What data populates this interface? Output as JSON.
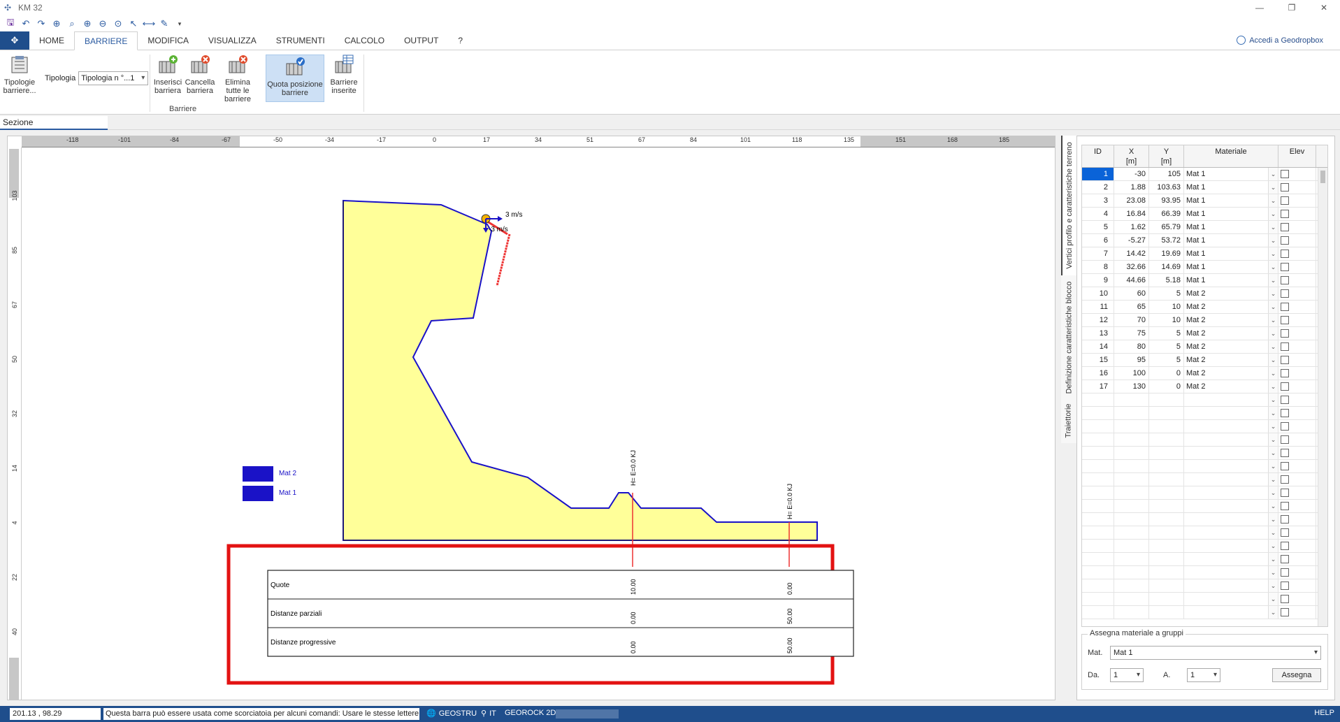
{
  "window": {
    "title": "KM 32"
  },
  "ribbon": {
    "tabs": [
      "HOME",
      "BARRIERE",
      "MODIFICA",
      "VISUALIZZA",
      "STRUMENTI",
      "CALCOLO",
      "OUTPUT",
      "?"
    ],
    "active_tab": "BARRIERE",
    "account_label": "Accedi a Geodropbox",
    "buttons": {
      "tipologie": "Tipologie barriere...",
      "tipologia_label": "Tipologia",
      "tipologia_value": "Tipologia n °...1",
      "inserisci": "Inserisci barriera",
      "cancella": "Cancella barriera",
      "elimina": "Elimina tutte le barriere",
      "quota": "Quota posizione barriere",
      "inserite": "Barriere inserite"
    },
    "group_label": "Barriere"
  },
  "section_tab": "Sezione",
  "canvas": {
    "h_ruler_labels": [
      "-118",
      "-101",
      "-84",
      "-67",
      "-50",
      "-34",
      "-17",
      "0",
      "17",
      "34",
      "51",
      "67",
      "84",
      "101",
      "118",
      "135",
      "151",
      "168",
      "185"
    ],
    "v_ruler_labels": [
      "103",
      "85",
      "67",
      "50",
      "32",
      "14",
      "4",
      "22",
      "40"
    ],
    "legend": [
      {
        "label": "Mat 2",
        "color": "#1a12c7"
      },
      {
        "label": "Mat 1",
        "color": "#1a12c7"
      }
    ],
    "velocity_label_1": "3 m/s",
    "velocity_label_2": "-3 m/s",
    "barrier_labels": [
      "H= E=0.0 KJ",
      "H= E=0.0 KJ"
    ],
    "table": {
      "rows": [
        "Quote",
        "Distanze parziali",
        "Distanze progressive"
      ],
      "col1": [
        "10.00",
        "0.00",
        "0.00"
      ],
      "col2": [
        "0.00",
        "50.00",
        "50.00"
      ]
    }
  },
  "side_tabs": [
    "Vertici profilo e caratteristiche terreno",
    "Definizione caratteristiche blocco",
    "Traiettorie"
  ],
  "grid": {
    "headers": {
      "id": "ID",
      "x": "X",
      "x_unit": "[m]",
      "y": "Y",
      "y_unit": "[m]",
      "material": "Materiale",
      "elev": "Elev"
    },
    "rows": [
      {
        "id": "1",
        "x": "-30",
        "y": "105",
        "mat": "Mat 1"
      },
      {
        "id": "2",
        "x": "1.88",
        "y": "103.63",
        "mat": "Mat 1"
      },
      {
        "id": "3",
        "x": "23.08",
        "y": "93.95",
        "mat": "Mat 1"
      },
      {
        "id": "4",
        "x": "16.84",
        "y": "66.39",
        "mat": "Mat 1"
      },
      {
        "id": "5",
        "x": "1.62",
        "y": "65.79",
        "mat": "Mat 1"
      },
      {
        "id": "6",
        "x": "-5.27",
        "y": "53.72",
        "mat": "Mat 1"
      },
      {
        "id": "7",
        "x": "14.42",
        "y": "19.69",
        "mat": "Mat 1"
      },
      {
        "id": "8",
        "x": "32.66",
        "y": "14.69",
        "mat": "Mat 1"
      },
      {
        "id": "9",
        "x": "44.66",
        "y": "5.18",
        "mat": "Mat 1"
      },
      {
        "id": "10",
        "x": "60",
        "y": "5",
        "mat": "Mat 2"
      },
      {
        "id": "11",
        "x": "65",
        "y": "10",
        "mat": "Mat 2"
      },
      {
        "id": "12",
        "x": "70",
        "y": "10",
        "mat": "Mat 2"
      },
      {
        "id": "13",
        "x": "75",
        "y": "5",
        "mat": "Mat 2"
      },
      {
        "id": "14",
        "x": "80",
        "y": "5",
        "mat": "Mat 2"
      },
      {
        "id": "15",
        "x": "95",
        "y": "5",
        "mat": "Mat 2"
      },
      {
        "id": "16",
        "x": "100",
        "y": "0",
        "mat": "Mat 2"
      },
      {
        "id": "17",
        "x": "130",
        "y": "0",
        "mat": "Mat 2"
      }
    ]
  },
  "assign": {
    "title": "Assegna materiale a gruppi",
    "mat_label": "Mat.",
    "mat_value": "Mat 1",
    "from_label": "Da.",
    "from_value": "1",
    "to_label": "A.",
    "to_value": "1",
    "button": "Assegna"
  },
  "status": {
    "coords": "201.13 , 98.29",
    "hint": "Questa barra può essere usata come scorciatoia per alcuni comandi: Usare le stesse lettere dei",
    "geostru": "GEOSTRU",
    "lang": "IT",
    "product": "GEOROCK 2D",
    "help": "HELP"
  }
}
